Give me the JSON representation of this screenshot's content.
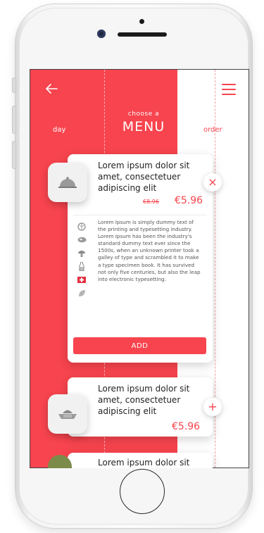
{
  "header": {
    "subtitle": "choose a",
    "title": "MENU",
    "tab_left": "day",
    "tab_right": "order"
  },
  "icons": {
    "back": "arrow-left",
    "menu": "hamburger",
    "close": "×",
    "plus": "+"
  },
  "colors": {
    "accent": "#f7444e"
  },
  "cards": [
    {
      "title": "Lorem ipsum dolor sit amet, consectetuer adipiscing elit",
      "old_price": "€8.96",
      "price": "€5.96",
      "description": "Lorem Ipsum is simply dummy text of the printing and typesetting industry. Lorem Ipsum has been the industry's standard dummy text ever since the 1500s, when an unknown printer took a galley of type and scrambled it to make a type specimen book. It has survived not only five centuries, but also the leap into electronic typesetting.",
      "add_label": "ADD"
    },
    {
      "title": "Lorem ipsum dolor sit amet, consectetuer adipiscing elit",
      "price": "€5.96"
    },
    {
      "title": "Lorem ipsum dolor sit"
    }
  ]
}
